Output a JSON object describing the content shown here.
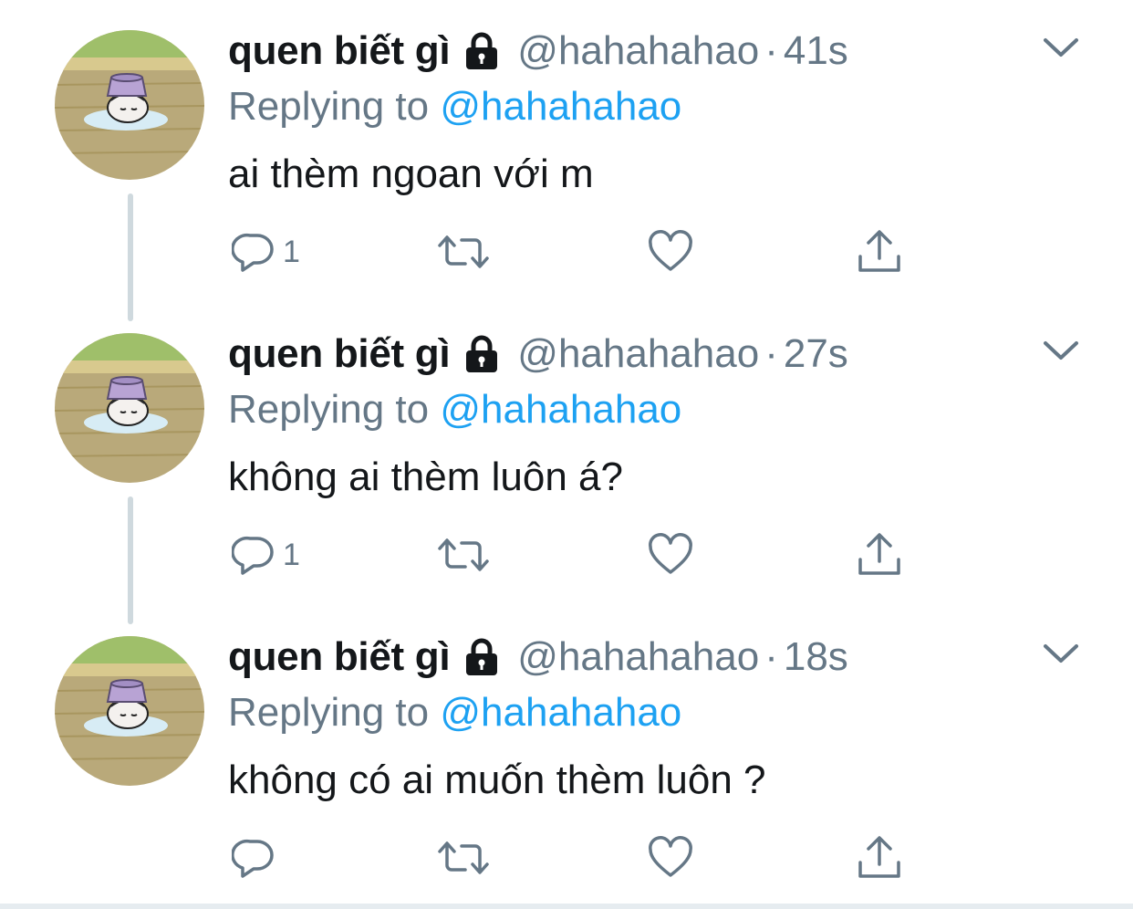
{
  "tweets": [
    {
      "name": "quen biết gì",
      "handle": "@hahahahao",
      "separator": "·",
      "time": "41s",
      "replying_prefix": "Replying to",
      "replying_handle": "@hahahahao",
      "text": "ai thèm ngoan với m",
      "reply_count": "1",
      "has_thread_line": true
    },
    {
      "name": "quen biết gì",
      "handle": "@hahahahao",
      "separator": "·",
      "time": "27s",
      "replying_prefix": "Replying to",
      "replying_handle": "@hahahahao",
      "text": "không ai thèm luôn á?",
      "reply_count": "1",
      "has_thread_line": true
    },
    {
      "name": "quen biết gì",
      "handle": "@hahahahao",
      "separator": "·",
      "time": "18s",
      "replying_prefix": "Replying to",
      "replying_handle": "@hahahahao",
      "text": "không có ai muốn thèm luôn ?",
      "reply_count": "",
      "has_thread_line": false
    }
  ],
  "icons": {
    "protected": "lock-icon",
    "menu": "chevron-down-icon",
    "reply": "reply-icon",
    "retweet": "retweet-icon",
    "like": "heart-icon",
    "share": "share-icon"
  },
  "colors": {
    "text": "#14171a",
    "muted": "#657786",
    "link": "#1da1f2",
    "thread_line": "#cfd9de"
  }
}
